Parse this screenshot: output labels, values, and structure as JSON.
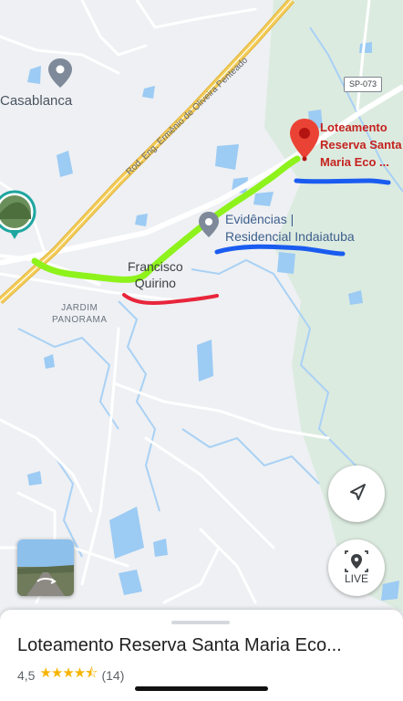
{
  "map": {
    "places": {
      "casablanca": "Casablanca",
      "jardim_panorama": "JARDIM\nPANORAMA",
      "francisco_quirino": "Francisco\nQuirino"
    },
    "road_name": "Rod. Eng. Ermênio de Oliveira Penteado",
    "route_shield": "SP-073",
    "pois": {
      "evidencias": "Evidências |\nResidencial Indaiatuba"
    },
    "selected_place_label": "Loteamento\nReserva Santa\nMaria Eco ...",
    "colors": {
      "marker": "#ea4335",
      "green_annotation": "#8ef21b",
      "blue_annotation": "#1a5cf0",
      "red_annotation": "#e8253b",
      "water": "#9ccbf4",
      "park": "#dcebe0",
      "highway": "#f3cd5a"
    }
  },
  "controls": {
    "my_location_icon": "navigation-arrow-icon",
    "live_label": "LIVE"
  },
  "sheet": {
    "title": "Loteamento Reserva Santa Maria Eco...",
    "rating_value": "4,5",
    "rating_stars": 4.5,
    "stars_text": "★★★★⯪",
    "review_count": "(14)"
  }
}
